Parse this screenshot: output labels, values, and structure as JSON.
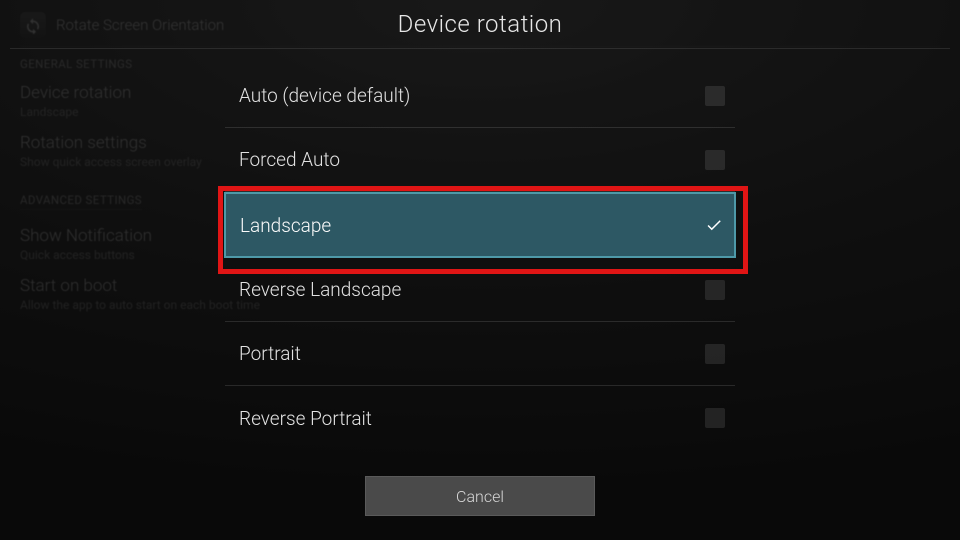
{
  "bg": {
    "app_name": "Rotate Screen Orientation",
    "sections": {
      "general": "GENERAL SETTINGS",
      "advanced": "ADVANCED SETTINGS"
    },
    "items": {
      "device_rotation": {
        "title": "Device rotation",
        "sub": "Landscape"
      },
      "rotation_settings": {
        "title": "Rotation settings",
        "sub": "Show quick access screen overlay"
      },
      "show_notification": {
        "title": "Show Notification",
        "sub": "Quick access buttons"
      },
      "start_on_boot": {
        "title": "Start on boot",
        "sub": "Allow the app to auto start on each boot time"
      }
    }
  },
  "dialog": {
    "title": "Device rotation",
    "options": [
      {
        "label": "Auto (device default)",
        "selected": false
      },
      {
        "label": "Forced Auto",
        "selected": false
      },
      {
        "label": "Landscape",
        "selected": true
      },
      {
        "label": "Reverse Landscape",
        "selected": false
      },
      {
        "label": "Portrait",
        "selected": false
      },
      {
        "label": "Reverse Portrait",
        "selected": false
      }
    ],
    "cancel": "Cancel"
  }
}
